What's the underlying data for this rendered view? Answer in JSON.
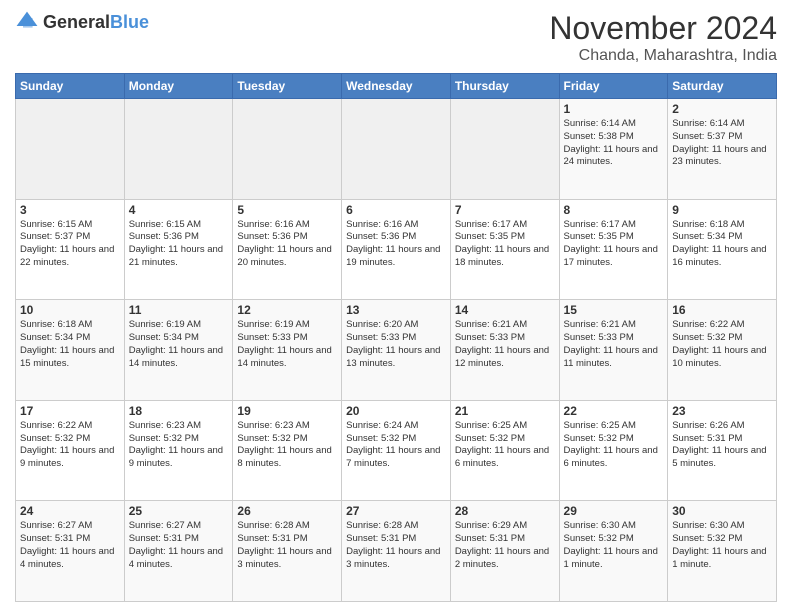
{
  "logo": {
    "general": "General",
    "blue": "Blue"
  },
  "header": {
    "month": "November 2024",
    "location": "Chanda, Maharashtra, India"
  },
  "weekdays": [
    "Sunday",
    "Monday",
    "Tuesday",
    "Wednesday",
    "Thursday",
    "Friday",
    "Saturday"
  ],
  "weeks": [
    [
      {
        "day": "",
        "info": ""
      },
      {
        "day": "",
        "info": ""
      },
      {
        "day": "",
        "info": ""
      },
      {
        "day": "",
        "info": ""
      },
      {
        "day": "",
        "info": ""
      },
      {
        "day": "1",
        "info": "Sunrise: 6:14 AM\nSunset: 5:38 PM\nDaylight: 11 hours and 24 minutes."
      },
      {
        "day": "2",
        "info": "Sunrise: 6:14 AM\nSunset: 5:37 PM\nDaylight: 11 hours and 23 minutes."
      }
    ],
    [
      {
        "day": "3",
        "info": "Sunrise: 6:15 AM\nSunset: 5:37 PM\nDaylight: 11 hours and 22 minutes."
      },
      {
        "day": "4",
        "info": "Sunrise: 6:15 AM\nSunset: 5:36 PM\nDaylight: 11 hours and 21 minutes."
      },
      {
        "day": "5",
        "info": "Sunrise: 6:16 AM\nSunset: 5:36 PM\nDaylight: 11 hours and 20 minutes."
      },
      {
        "day": "6",
        "info": "Sunrise: 6:16 AM\nSunset: 5:36 PM\nDaylight: 11 hours and 19 minutes."
      },
      {
        "day": "7",
        "info": "Sunrise: 6:17 AM\nSunset: 5:35 PM\nDaylight: 11 hours and 18 minutes."
      },
      {
        "day": "8",
        "info": "Sunrise: 6:17 AM\nSunset: 5:35 PM\nDaylight: 11 hours and 17 minutes."
      },
      {
        "day": "9",
        "info": "Sunrise: 6:18 AM\nSunset: 5:34 PM\nDaylight: 11 hours and 16 minutes."
      }
    ],
    [
      {
        "day": "10",
        "info": "Sunrise: 6:18 AM\nSunset: 5:34 PM\nDaylight: 11 hours and 15 minutes."
      },
      {
        "day": "11",
        "info": "Sunrise: 6:19 AM\nSunset: 5:34 PM\nDaylight: 11 hours and 14 minutes."
      },
      {
        "day": "12",
        "info": "Sunrise: 6:19 AM\nSunset: 5:33 PM\nDaylight: 11 hours and 14 minutes."
      },
      {
        "day": "13",
        "info": "Sunrise: 6:20 AM\nSunset: 5:33 PM\nDaylight: 11 hours and 13 minutes."
      },
      {
        "day": "14",
        "info": "Sunrise: 6:21 AM\nSunset: 5:33 PM\nDaylight: 11 hours and 12 minutes."
      },
      {
        "day": "15",
        "info": "Sunrise: 6:21 AM\nSunset: 5:33 PM\nDaylight: 11 hours and 11 minutes."
      },
      {
        "day": "16",
        "info": "Sunrise: 6:22 AM\nSunset: 5:32 PM\nDaylight: 11 hours and 10 minutes."
      }
    ],
    [
      {
        "day": "17",
        "info": "Sunrise: 6:22 AM\nSunset: 5:32 PM\nDaylight: 11 hours and 9 minutes."
      },
      {
        "day": "18",
        "info": "Sunrise: 6:23 AM\nSunset: 5:32 PM\nDaylight: 11 hours and 9 minutes."
      },
      {
        "day": "19",
        "info": "Sunrise: 6:23 AM\nSunset: 5:32 PM\nDaylight: 11 hours and 8 minutes."
      },
      {
        "day": "20",
        "info": "Sunrise: 6:24 AM\nSunset: 5:32 PM\nDaylight: 11 hours and 7 minutes."
      },
      {
        "day": "21",
        "info": "Sunrise: 6:25 AM\nSunset: 5:32 PM\nDaylight: 11 hours and 6 minutes."
      },
      {
        "day": "22",
        "info": "Sunrise: 6:25 AM\nSunset: 5:32 PM\nDaylight: 11 hours and 6 minutes."
      },
      {
        "day": "23",
        "info": "Sunrise: 6:26 AM\nSunset: 5:31 PM\nDaylight: 11 hours and 5 minutes."
      }
    ],
    [
      {
        "day": "24",
        "info": "Sunrise: 6:27 AM\nSunset: 5:31 PM\nDaylight: 11 hours and 4 minutes."
      },
      {
        "day": "25",
        "info": "Sunrise: 6:27 AM\nSunset: 5:31 PM\nDaylight: 11 hours and 4 minutes."
      },
      {
        "day": "26",
        "info": "Sunrise: 6:28 AM\nSunset: 5:31 PM\nDaylight: 11 hours and 3 minutes."
      },
      {
        "day": "27",
        "info": "Sunrise: 6:28 AM\nSunset: 5:31 PM\nDaylight: 11 hours and 3 minutes."
      },
      {
        "day": "28",
        "info": "Sunrise: 6:29 AM\nSunset: 5:31 PM\nDaylight: 11 hours and 2 minutes."
      },
      {
        "day": "29",
        "info": "Sunrise: 6:30 AM\nSunset: 5:32 PM\nDaylight: 11 hours and 1 minute."
      },
      {
        "day": "30",
        "info": "Sunrise: 6:30 AM\nSunset: 5:32 PM\nDaylight: 11 hours and 1 minute."
      }
    ]
  ]
}
